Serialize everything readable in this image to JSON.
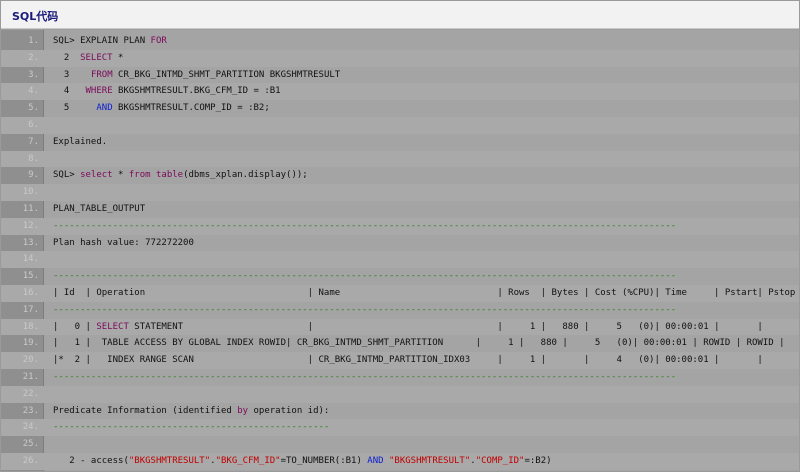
{
  "title": "SQL代码",
  "lines": [
    {
      "n": "1.",
      "t": "SQL> EXPLAIN PLAN FOR"
    },
    {
      "n": "2.",
      "t": "  2  SELECT *"
    },
    {
      "n": "3.",
      "t": "  3    FROM CR_BKG_INTMD_SHMT_PARTITION BKGSHMTRESULT"
    },
    {
      "n": "4.",
      "t": "  4   WHERE BKGSHMTRESULT.BKG_CFM_ID = :B1"
    },
    {
      "n": "5.",
      "t": "  5     AND BKGSHMTRESULT.COMP_ID = :B2;"
    },
    {
      "n": "6.",
      "t": ""
    },
    {
      "n": "7.",
      "t": "Explained."
    },
    {
      "n": "8.",
      "t": ""
    },
    {
      "n": "9.",
      "t": "SQL> select * from table(dbms_xplan.display());"
    },
    {
      "n": "10.",
      "t": ""
    },
    {
      "n": "11.",
      "t": "PLAN_TABLE_OUTPUT"
    },
    {
      "n": "12.",
      "t": "-------------------------------------------------------------------------------------------------------------------"
    },
    {
      "n": "13.",
      "t": "Plan hash value: 772272200"
    },
    {
      "n": "14.",
      "t": ""
    },
    {
      "n": "15.",
      "t": "-------------------------------------------------------------------------------------------------------------------"
    },
    {
      "n": "16.",
      "t": "| Id  | Operation                              | Name                             | Rows  | Bytes | Cost (%CPU)| Time     | Pstart| Pstop |"
    },
    {
      "n": "17.",
      "t": "-------------------------------------------------------------------------------------------------------------------"
    },
    {
      "n": "18.",
      "t": "|   0 | SELECT STATEMENT                       |                                  |     1 |   880 |     5   (0)| 00:00:01 |       |       |"
    },
    {
      "n": "19.",
      "t": "|   1 |  TABLE ACCESS BY GLOBAL INDEX ROWID| CR_BKG_INTMD_SHMT_PARTITION      |     1 |   880 |     5   (0)| 00:00:01 | ROWID | ROWID |"
    },
    {
      "n": "20.",
      "t": "|*  2 |   INDEX RANGE SCAN                     | CR_BKG_INTMD_PARTITION_IDX03     |     1 |       |     4   (0)| 00:00:01 |       |       |"
    },
    {
      "n": "21.",
      "t": "-------------------------------------------------------------------------------------------------------------------"
    },
    {
      "n": "22.",
      "t": ""
    },
    {
      "n": "23.",
      "t": "Predicate Information (identified by operation id):"
    },
    {
      "n": "24.",
      "t": "---------------------------------------------------"
    },
    {
      "n": "25.",
      "t": ""
    },
    {
      "n": "26.",
      "t": "   2 - access(\"BKGSHMTRESULT\".\"BKG_CFM_ID\"=TO_NUMBER(:B1) AND \"BKGSHMTRESULT\".\"COMP_ID\"=:B2)"
    }
  ],
  "colors": {
    "keyword": "#7a0a5a",
    "keyword_blue": "#0b1fd0",
    "string": "#c20000",
    "separator": "#2e7d1e"
  }
}
